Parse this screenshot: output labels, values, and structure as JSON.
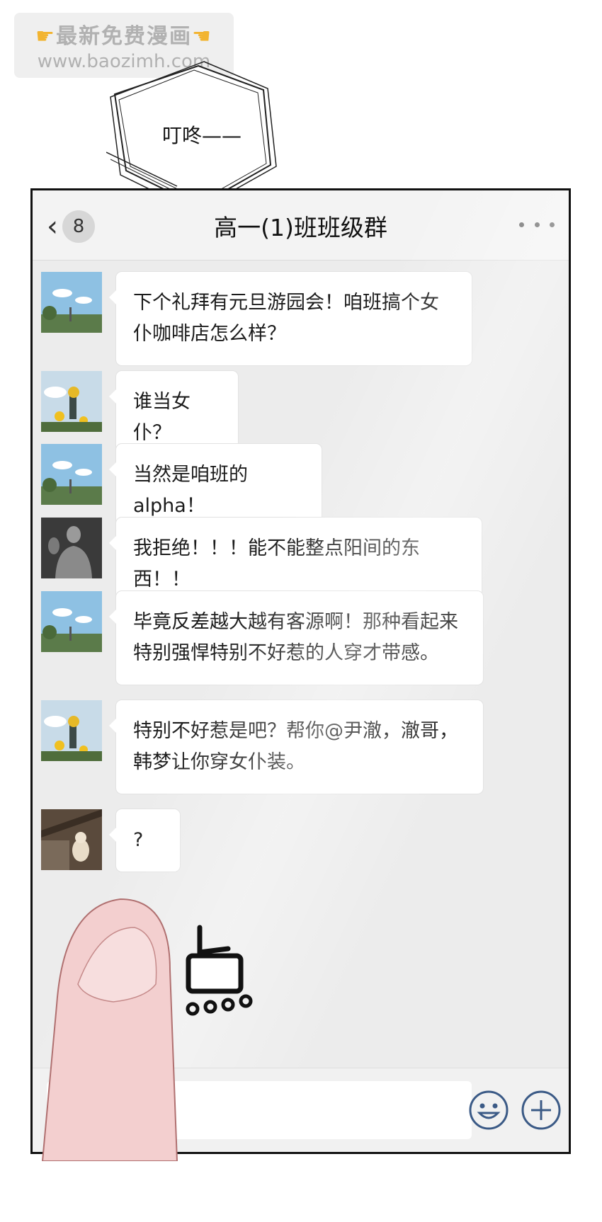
{
  "watermark": {
    "line1": "最新免费漫画",
    "line2": "www.baozimh.com"
  },
  "sfx_text": "叮咚——",
  "header": {
    "unread_count": "8",
    "title": "高一(1)班班级群"
  },
  "messages": [
    {
      "avatar": "sky-trees-avatar",
      "text": "下个礼拜有元旦游园会！咱班搞个女仆咖啡店怎么样？"
    },
    {
      "avatar": "sunflower-avatar",
      "text": "谁当女仆？"
    },
    {
      "avatar": "sky-trees-avatar",
      "text": "当然是咱班的alpha！"
    },
    {
      "avatar": "muscle-man-avatar",
      "text": "我拒绝！！！能不能整点阳间的东西！！"
    },
    {
      "avatar": "sky-trees-avatar",
      "text": "毕竟反差越大越有客源啊！那种看起来特别强悍特别不好惹的人穿才带感。"
    },
    {
      "avatar": "sunflower-avatar",
      "text": "特别不好惹是吧？帮你@尹澈，澈哥，韩梦让你穿女仆装。"
    },
    {
      "avatar": "cat-avatar",
      "text": "?"
    }
  ],
  "tap_sfx": "点",
  "colors": {
    "icon_blue": "#3b5a86",
    "chat_bg": "#ececec",
    "bubble_bg": "#ffffff"
  },
  "icons": {
    "back": "chevron-left-icon",
    "more": "more-dots-icon",
    "emoji": "smile-face-icon",
    "add": "plus-circle-icon"
  }
}
